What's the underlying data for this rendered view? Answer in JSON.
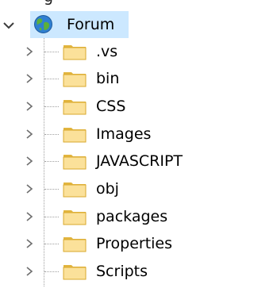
{
  "tree": {
    "partial_top_text": "g",
    "root": {
      "label": "Forum",
      "icon": "globe-icon",
      "expanded": true,
      "selected_color": "#cce8ff"
    },
    "items": [
      {
        "label": ".vs",
        "icon": "folder-icon"
      },
      {
        "label": "bin",
        "icon": "folder-icon"
      },
      {
        "label": "CSS",
        "icon": "folder-icon"
      },
      {
        "label": "Images",
        "icon": "folder-icon"
      },
      {
        "label": "JAVASCRIPT",
        "icon": "folder-icon"
      },
      {
        "label": "obj",
        "icon": "folder-icon"
      },
      {
        "label": "packages",
        "icon": "folder-icon"
      },
      {
        "label": "Properties",
        "icon": "folder-icon"
      },
      {
        "label": "Scripts",
        "icon": "folder-icon"
      }
    ]
  }
}
